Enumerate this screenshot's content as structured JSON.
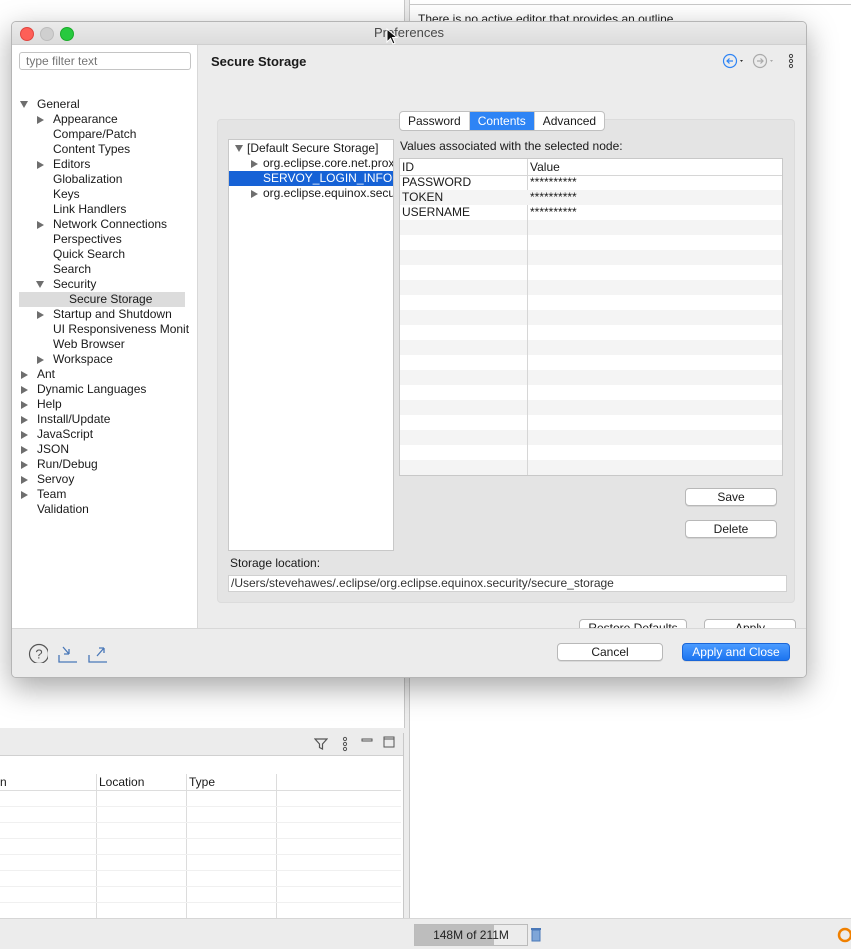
{
  "background": {
    "outline_message": "There is no active editor that provides an outline.",
    "columns": [
      "n",
      "Location",
      "Type"
    ],
    "heap_status": "148M of 211M"
  },
  "dialog": {
    "title": "Preferences",
    "filter_placeholder": "type filter text",
    "page_title": "Secure Storage",
    "tree": [
      {
        "label": "General",
        "level": 0,
        "state": "expanded"
      },
      {
        "label": "Appearance",
        "level": 1,
        "state": "collapsed"
      },
      {
        "label": "Compare/Patch",
        "level": 1,
        "state": "leaf"
      },
      {
        "label": "Content Types",
        "level": 1,
        "state": "leaf"
      },
      {
        "label": "Editors",
        "level": 1,
        "state": "collapsed"
      },
      {
        "label": "Globalization",
        "level": 1,
        "state": "leaf"
      },
      {
        "label": "Keys",
        "level": 1,
        "state": "leaf"
      },
      {
        "label": "Link Handlers",
        "level": 1,
        "state": "leaf"
      },
      {
        "label": "Network Connections",
        "level": 1,
        "state": "collapsed"
      },
      {
        "label": "Perspectives",
        "level": 1,
        "state": "leaf"
      },
      {
        "label": "Quick Search",
        "level": 1,
        "state": "leaf"
      },
      {
        "label": "Search",
        "level": 1,
        "state": "leaf"
      },
      {
        "label": "Security",
        "level": 1,
        "state": "expanded"
      },
      {
        "label": "Secure Storage",
        "level": 2,
        "state": "leaf",
        "selected": true
      },
      {
        "label": "Startup and Shutdown",
        "level": 1,
        "state": "collapsed"
      },
      {
        "label": "UI Responsiveness Monit",
        "level": 1,
        "state": "leaf"
      },
      {
        "label": "Web Browser",
        "level": 1,
        "state": "leaf"
      },
      {
        "label": "Workspace",
        "level": 1,
        "state": "collapsed"
      },
      {
        "label": "Ant",
        "level": 0,
        "state": "collapsed"
      },
      {
        "label": "Dynamic Languages",
        "level": 0,
        "state": "collapsed"
      },
      {
        "label": "Help",
        "level": 0,
        "state": "collapsed"
      },
      {
        "label": "Install/Update",
        "level": 0,
        "state": "collapsed"
      },
      {
        "label": "JavaScript",
        "level": 0,
        "state": "collapsed"
      },
      {
        "label": "JSON",
        "level": 0,
        "state": "collapsed"
      },
      {
        "label": "Run/Debug",
        "level": 0,
        "state": "collapsed"
      },
      {
        "label": "Servoy",
        "level": 0,
        "state": "collapsed"
      },
      {
        "label": "Team",
        "level": 0,
        "state": "collapsed"
      },
      {
        "label": "Validation",
        "level": 0,
        "state": "leaf"
      }
    ],
    "tabs": [
      {
        "label": "Password",
        "active": false
      },
      {
        "label": "Contents",
        "active": true
      },
      {
        "label": "Advanced",
        "active": false
      }
    ],
    "nodes": [
      {
        "label": "[Default Secure Storage]",
        "level": 0,
        "state": "expanded"
      },
      {
        "label": "org.eclipse.core.net.prox",
        "level": 1,
        "state": "collapsed"
      },
      {
        "label": "SERVOY_LOGIN_INFO",
        "level": 1,
        "state": "leaf",
        "selected": true
      },
      {
        "label": "org.eclipse.equinox.secu",
        "level": 1,
        "state": "collapsed"
      }
    ],
    "values_label": "Values associated with the selected node:",
    "table_headers": {
      "id": "ID",
      "value": "Value"
    },
    "table_rows": [
      {
        "id": "PASSWORD",
        "value": "**********"
      },
      {
        "id": "TOKEN",
        "value": "**********"
      },
      {
        "id": "USERNAME",
        "value": "**********"
      }
    ],
    "save_label": "Save",
    "delete_label": "Delete",
    "storage_location_label": "Storage location:",
    "storage_location_path": "/Users/stevehawes/.eclipse/org.eclipse.equinox.security/secure_storage",
    "restore_defaults_label": "Restore Defaults",
    "apply_label": "Apply",
    "cancel_label": "Cancel",
    "apply_close_label": "Apply and Close",
    "accent_color": "#2e84f5",
    "selection_color": "#1662d6"
  }
}
